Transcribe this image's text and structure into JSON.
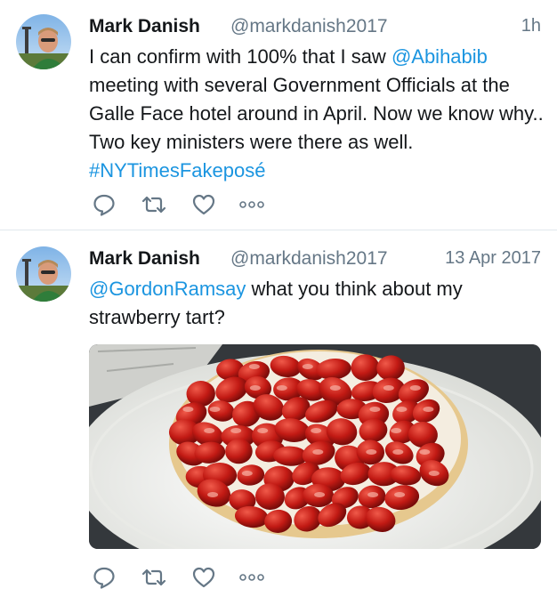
{
  "tweets": [
    {
      "author": {
        "name": "Mark Danish",
        "handle": "@markdanish2017"
      },
      "time": "1h",
      "body": [
        {
          "text": "I can confirm with 100% that I saw ",
          "link": false
        },
        {
          "text": "@Abihabib",
          "link": true
        },
        {
          "text": " meeting with several Government Officials at the Galle Face hotel around in April. Now we know why..  Two key ministers were there as well. ",
          "link": false
        },
        {
          "text": "#NYTimesFakeposé",
          "link": true
        }
      ]
    },
    {
      "author": {
        "name": "Mark Danish",
        "handle": "@markdanish2017"
      },
      "time": "13 Apr 2017",
      "body": [
        {
          "text": "@GordonRamsay",
          "link": true
        },
        {
          "text": " what you think about my strawberry tart?",
          "link": false
        }
      ]
    }
  ],
  "icons": {
    "reply": "reply-icon",
    "retweet": "retweet-icon",
    "like": "heart-icon",
    "more": "more-icon"
  },
  "colors": {
    "link": "#1b95e0",
    "secondary_text": "#657786",
    "icon": "#657786",
    "divider": "#e1e8ed"
  }
}
